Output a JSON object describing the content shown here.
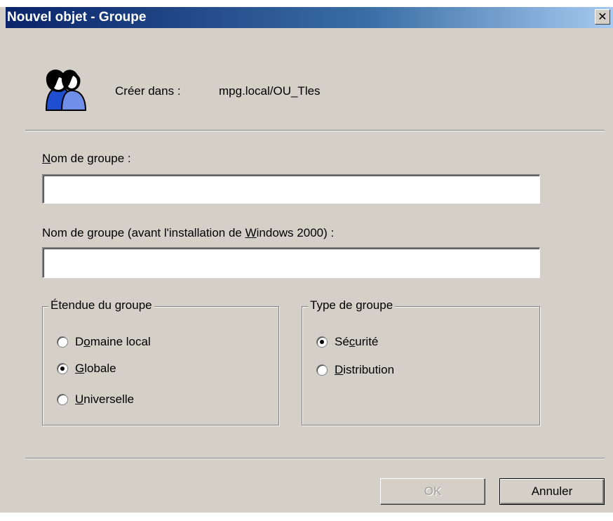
{
  "window": {
    "title": "Nouvel objet - Groupe",
    "close_glyph": "✕"
  },
  "header": {
    "icon": "group-users-icon",
    "create_in_label": "Créer dans :",
    "create_in_value": "mpg.local/OU_Tles"
  },
  "fields": {
    "group_name": {
      "label_pre": "",
      "label_ul": "N",
      "label_post": "om de groupe :",
      "value": ""
    },
    "group_name_pre2000": {
      "label_pre": "Nom de groupe (avant l'installation de ",
      "label_ul": "W",
      "label_post": "indows 2000) :",
      "value": ""
    }
  },
  "scope": {
    "legend": "Étendue du groupe",
    "options": [
      {
        "pre": "D",
        "ul": "o",
        "post": "maine local",
        "selected": false
      },
      {
        "pre": "",
        "ul": "G",
        "post": "lobale",
        "selected": true
      },
      {
        "pre": "",
        "ul": "U",
        "post": "niverselle",
        "selected": false
      }
    ]
  },
  "type": {
    "legend": "Type de groupe",
    "options": [
      {
        "pre": "Sé",
        "ul": "c",
        "post": "urité",
        "selected": true
      },
      {
        "pre": "",
        "ul": "D",
        "post": "istribution",
        "selected": false
      }
    ]
  },
  "buttons": {
    "ok": {
      "label": "OK",
      "enabled": false
    },
    "cancel": {
      "label": "Annuler",
      "enabled": true
    }
  }
}
